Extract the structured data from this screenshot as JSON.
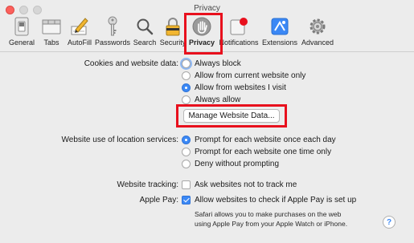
{
  "window": {
    "title": "Privacy"
  },
  "toolbar": {
    "items": [
      {
        "label": "General",
        "icon": "general-switch-icon"
      },
      {
        "label": "Tabs",
        "icon": "tabs-icon"
      },
      {
        "label": "AutoFill",
        "icon": "autofill-pencil-icon"
      },
      {
        "label": "Passwords",
        "icon": "key-icon"
      },
      {
        "label": "Search",
        "icon": "magnifier-icon"
      },
      {
        "label": "Security",
        "icon": "padlock-icon"
      },
      {
        "label": "Privacy",
        "icon": "hand-icon"
      },
      {
        "label": "Notifications",
        "icon": "notification-badge-icon"
      },
      {
        "label": "Extensions",
        "icon": "puzzle-icon"
      },
      {
        "label": "Advanced",
        "icon": "gear-icon"
      }
    ],
    "selected": "Privacy"
  },
  "cookies": {
    "label": "Cookies and website data:",
    "options": [
      "Always block",
      "Allow from current website only",
      "Allow from websites I visit",
      "Always allow"
    ],
    "selected_index": 2
  },
  "manage_button": {
    "label": "Manage Website Data..."
  },
  "location": {
    "label": "Website use of location services:",
    "options": [
      "Prompt for each website once each day",
      "Prompt for each website one time only",
      "Deny without prompting"
    ],
    "selected_index": 0
  },
  "tracking": {
    "label": "Website tracking:",
    "option": "Ask websites not to track me",
    "checked": false
  },
  "apple_pay": {
    "label": "Apple Pay:",
    "option": "Allow websites to check if Apple Pay is set up",
    "checked": true,
    "note_line1": "Safari allows you to make purchases on the web",
    "note_line2": "using Apple Pay from your Apple Watch or iPhone."
  },
  "help": {
    "label": "?"
  },
  "colors": {
    "highlight": "#e8101d",
    "accent": "#3b88f5"
  }
}
